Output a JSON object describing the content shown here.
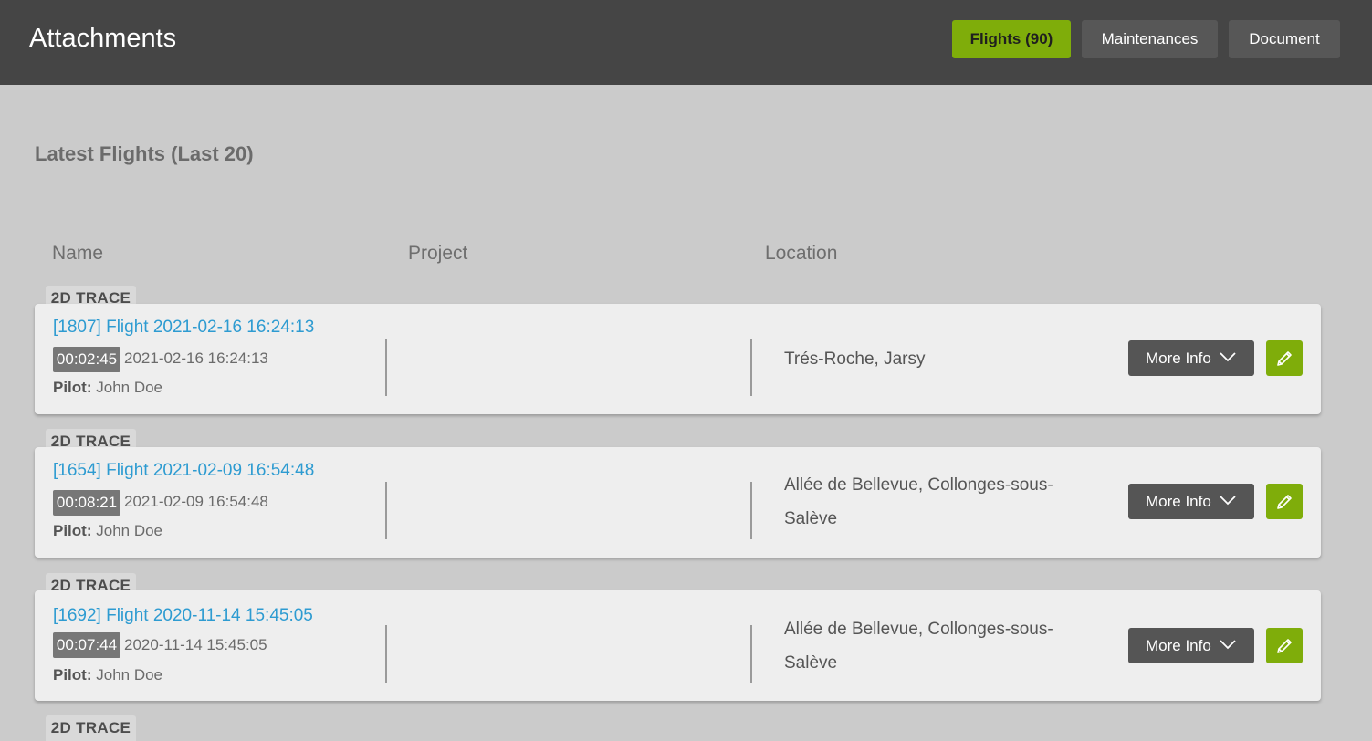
{
  "header": {
    "title": "Attachments",
    "tabs": [
      {
        "label": "Flights (90)",
        "active": true
      },
      {
        "label": "Maintenances",
        "active": false
      },
      {
        "label": "Document",
        "active": false
      }
    ]
  },
  "section": {
    "title": "Latest Flights (Last 20)",
    "columns": {
      "name": "Name",
      "project": "Project",
      "location": "Location"
    }
  },
  "flights": [
    {
      "tag": "2D TRACE",
      "title": "[1807] Flight 2021-02-16 16:24:13",
      "duration": "00:02:45",
      "datetime": "2021-02-16 16:24:13",
      "pilot_label": "Pilot:",
      "pilot": "John Doe",
      "project": "",
      "location": "Trés-Roche, Jarsy",
      "more_label": "More Info"
    },
    {
      "tag": "2D TRACE",
      "title": "[1654] Flight 2021-02-09 16:54:48",
      "duration": "00:08:21",
      "datetime": "2021-02-09 16:54:48",
      "pilot_label": "Pilot:",
      "pilot": "John Doe",
      "project": "",
      "location": "Allée de Bellevue, Collonges-sous-Salève",
      "more_label": "More Info"
    },
    {
      "tag": "2D TRACE",
      "title": "[1692] Flight 2020-11-14 15:45:05",
      "duration": "00:07:44",
      "datetime": "2020-11-14 15:45:05",
      "pilot_label": "Pilot:",
      "pilot": "John Doe",
      "project": "",
      "location": "Allée de Bellevue, Collonges-sous-Salève",
      "more_label": "More Info"
    },
    {
      "tag": "2D TRACE"
    }
  ],
  "colors": {
    "header_bg": "#454545",
    "accent": "#7fad0a",
    "link": "#2d9bd1",
    "page_bg": "#cbcbcb",
    "card_bg": "#eeeeee"
  },
  "icons": {
    "more_info": "chevron-down-icon",
    "edit": "pencil-icon"
  }
}
